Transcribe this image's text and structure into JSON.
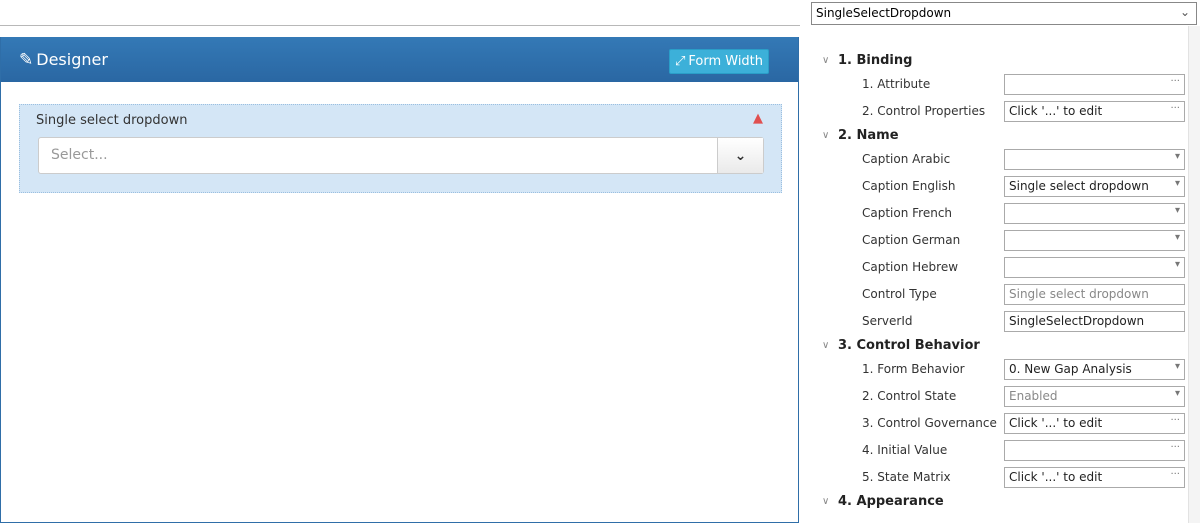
{
  "designer": {
    "title": "Designer",
    "form_width_label": "Form Width",
    "field": {
      "caption": "Single select dropdown",
      "placeholder": "Select..."
    }
  },
  "properties": {
    "object_selector": "SingleSelectDropdown",
    "sections": [
      {
        "title": "1. Binding",
        "rows": [
          {
            "label": "1. Attribute",
            "value": "",
            "editor": "ellipsis"
          },
          {
            "label": "2. Control Properties",
            "value": "Click '...' to edit",
            "editor": "ellipsis"
          }
        ]
      },
      {
        "title": "2. Name",
        "rows": [
          {
            "label": "Caption Arabic",
            "value": "",
            "editor": "dropdown"
          },
          {
            "label": "Caption English",
            "value": "Single select dropdown",
            "editor": "dropdown"
          },
          {
            "label": "Caption French",
            "value": "",
            "editor": "dropdown"
          },
          {
            "label": "Caption German",
            "value": "",
            "editor": "dropdown"
          },
          {
            "label": "Caption Hebrew",
            "value": "",
            "editor": "dropdown"
          },
          {
            "label": "Control Type",
            "value": "Single select dropdown",
            "editor": "readonly"
          },
          {
            "label": "ServerId",
            "value": "SingleSelectDropdown",
            "editor": "text"
          }
        ]
      },
      {
        "title": "3. Control Behavior",
        "rows": [
          {
            "label": "1. Form Behavior",
            "value": "0. New Gap Analysis",
            "editor": "dropdown"
          },
          {
            "label": "2. Control State",
            "value": "Enabled",
            "editor": "dropdown-readonly"
          },
          {
            "label": "3. Control Governance",
            "value": "Click '...' to edit",
            "editor": "ellipsis"
          },
          {
            "label": "4. Initial Value",
            "value": "",
            "editor": "ellipsis"
          },
          {
            "label": "5. State Matrix",
            "value": "Click '...' to edit",
            "editor": "ellipsis"
          }
        ]
      },
      {
        "title": "4. Appearance",
        "rows": []
      }
    ]
  }
}
